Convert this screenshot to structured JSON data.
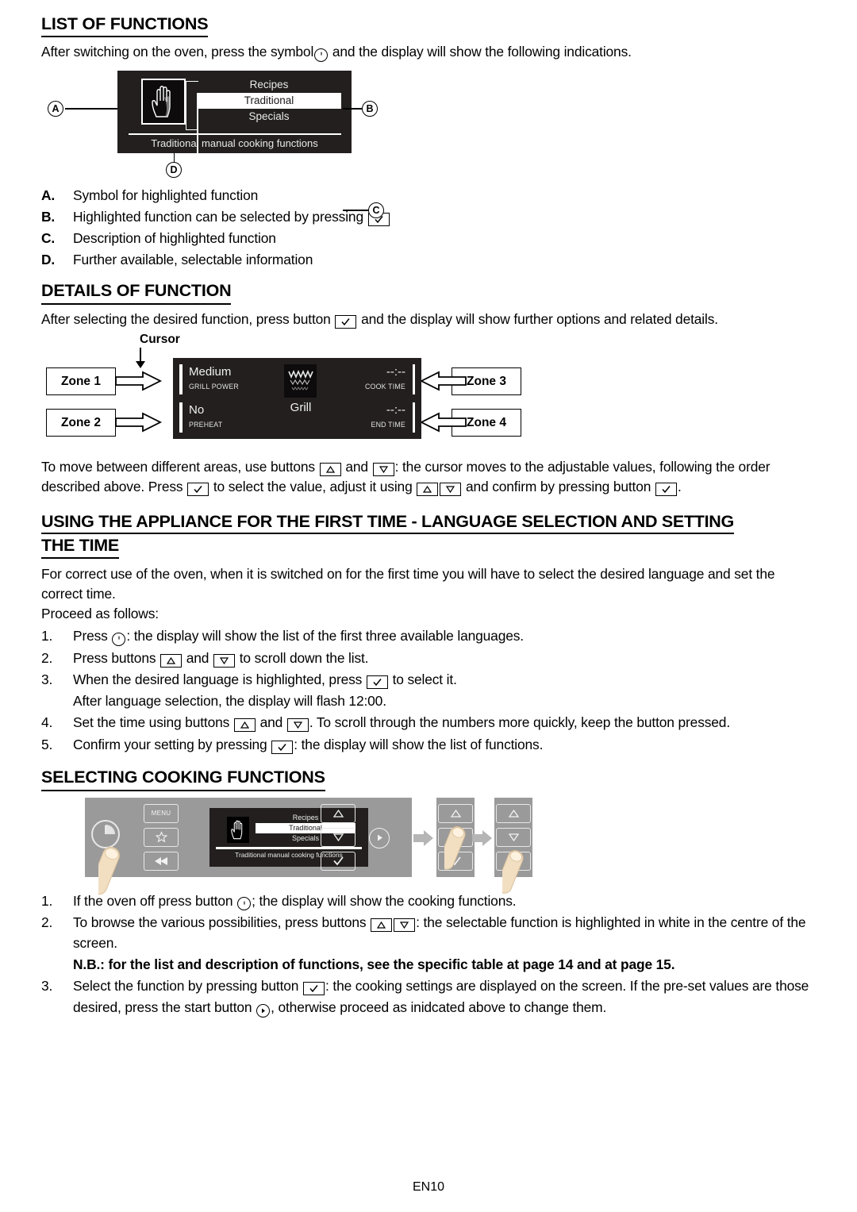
{
  "document": {
    "footer_page": "EN10"
  },
  "sections": {
    "list_of_functions": {
      "title": "LIST OF FUNCTIONS",
      "intro_before": "After switching on the oven, press the symbol",
      "intro_after": "and the display will show the following indications.",
      "figure": {
        "callouts": [
          "A",
          "B",
          "C",
          "D"
        ],
        "menu_items": [
          "Recipes",
          "Traditional",
          "Specials"
        ],
        "selected_item": "Traditional",
        "description": "Traditional manual cooking functions",
        "symbol_icon": "hand-icon"
      },
      "legend": [
        {
          "label": "A.",
          "text": "Symbol for highlighted function",
          "key": null
        },
        {
          "label": "B.",
          "text_before": "Highlighted function can be selected by pressing",
          "key": "check-key",
          "text_after": ""
        },
        {
          "label": "C.",
          "text": "Description of highlighted function",
          "key": null
        },
        {
          "label": "D.",
          "text": "Further available, selectable information",
          "key": null
        }
      ]
    },
    "details_of_function": {
      "title": "DETAILS OF FUNCTION",
      "intro_before": "After selecting the desired function, press button",
      "intro_after": "and the display will show further options and related details.",
      "figure": {
        "cursor_label": "Cursor",
        "zones": [
          {
            "name": "Zone 1",
            "value": "Medium",
            "caption": "GRILL POWER"
          },
          {
            "name": "Zone 2",
            "value": "No",
            "caption": "PREHEAT"
          },
          {
            "name": "Zone 3",
            "value": "--:--",
            "caption": "COOK TIME"
          },
          {
            "name": "Zone 4",
            "value": "--:--",
            "caption": "END TIME"
          }
        ],
        "function_icon": "grill-icon",
        "function_name": "Grill"
      },
      "paragraph": {
        "p1": "To move between different areas, use buttons",
        "p2": "and",
        "p3": ": the cursor moves to the adjustable values, following the order described above. Press",
        "p4": "to select the value, adjust it using",
        "p5": "and confirm by pressing button",
        "p6": "."
      }
    },
    "first_time": {
      "title_line1": "USING THE APPLIANCE FOR THE FIRST TIME - LANGUAGE SELECTION AND SETTING",
      "title_line2": "THE TIME",
      "intro": "For correct use of the oven, when it is switched on for the first time you will have to select the desired language and set the correct time.",
      "proceed": "Proceed as follows:",
      "steps": [
        {
          "num": "1.",
          "before": "Press",
          "key": "power-key",
          "after": ": the display will show the list of the first three available languages."
        },
        {
          "num": "2.",
          "before": "Press buttons",
          "key": "up-key",
          "mid": "and",
          "key2": "down-key",
          "after": "to scroll down the list."
        },
        {
          "num": "3.",
          "before": "When the desired language is highlighted, press",
          "key": "check-key",
          "after": "to select it.",
          "subline": "After language selection, the display will flash 12:00."
        },
        {
          "num": "4.",
          "before": "Set the time using buttons",
          "key": "up-key",
          "mid": "and",
          "key2": "down-key",
          "after": ". To scroll through the numbers more quickly, keep the button pressed."
        },
        {
          "num": "5.",
          "before": "Confirm your setting by pressing",
          "key": "check-key",
          "after": ": the display will show the list of functions."
        }
      ]
    },
    "selecting_cooking_functions": {
      "title": "SELECTING COOKING FUNCTIONS",
      "figure": {
        "panel_buttons": [
          "MENU",
          "star-icon",
          "rewind-icon",
          "power-clock-icon",
          "up-icon",
          "down-icon",
          "check-icon",
          "start-icon"
        ],
        "menu_button_label": "MENU",
        "menu_items": [
          "Recipes",
          "Traditional",
          "Specials"
        ],
        "selected_item": "Traditional",
        "description": "Traditional manual cooking functions"
      },
      "steps": [
        {
          "num": "1.",
          "before": "If the oven off press button",
          "key": "power-key",
          "after": "; the display will show the cooking functions."
        },
        {
          "num": "2.",
          "before": "To browse the various possibilities, press buttons",
          "key": "up-key",
          "key2": "down-key",
          "after": ": the selectable function is highlighted in white in the centre of the screen.",
          "nb": "N.B.: for the list and description of functions, see the specific table at page 14 and at page 15."
        },
        {
          "num": "3.",
          "before": "Select the function by pressing button",
          "key": "check-key",
          "mid": ": the cooking settings are displayed on the screen. If the pre-set values are those desired, press the start button",
          "key2": "start-key",
          "after": ", otherwise proceed as inidcated above to change them."
        }
      ]
    }
  },
  "colors": {
    "lcd_background": "#231f1f",
    "lcd_text": "#e9e9e9",
    "panel_background": "#9a9a9a",
    "highlight": "#ffffff"
  }
}
